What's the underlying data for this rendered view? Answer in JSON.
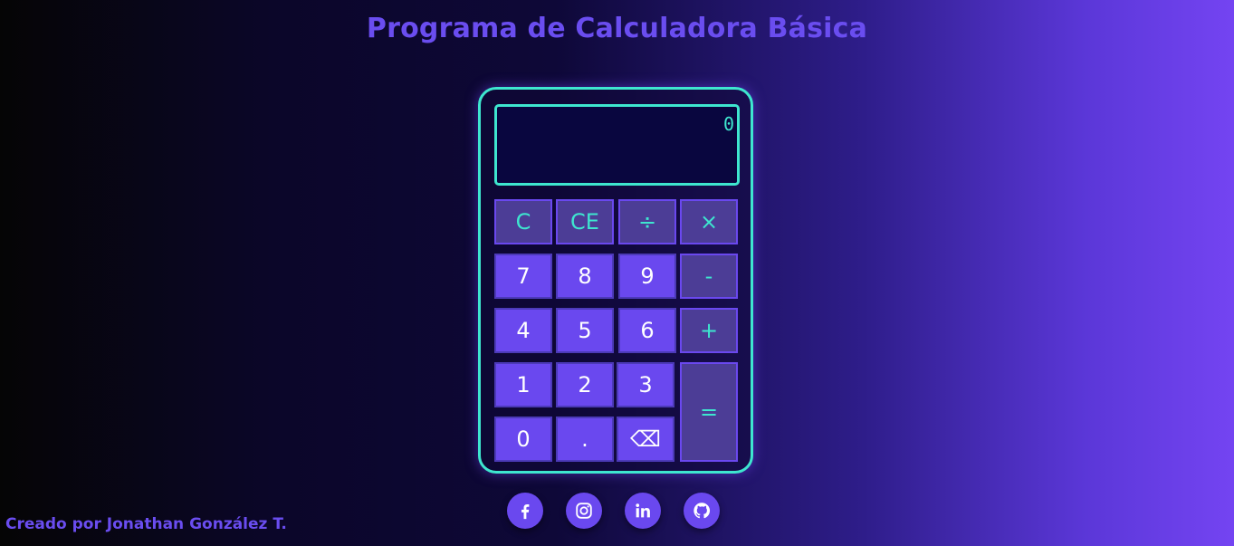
{
  "page": {
    "title": "Programa de Calculadora Básica"
  },
  "calculator": {
    "display_value": "0",
    "keys": {
      "clear": "C",
      "clear_entry": "CE",
      "divide": "÷",
      "multiply": "×",
      "seven": "7",
      "eight": "8",
      "nine": "9",
      "subtract": "-",
      "four": "4",
      "five": "5",
      "six": "6",
      "add": "+",
      "one": "1",
      "two": "2",
      "three": "3",
      "equals": "=",
      "zero": "0",
      "decimal": ".",
      "backspace": "⌫"
    }
  },
  "footer": {
    "credit": "Creado por Jonathan González T."
  },
  "social": [
    "facebook-icon",
    "instagram-icon",
    "linkedin-icon",
    "github-icon"
  ],
  "colors": {
    "accent": "#6a48ef",
    "highlight": "#3ee6cf",
    "display_bg": "#09063f"
  }
}
